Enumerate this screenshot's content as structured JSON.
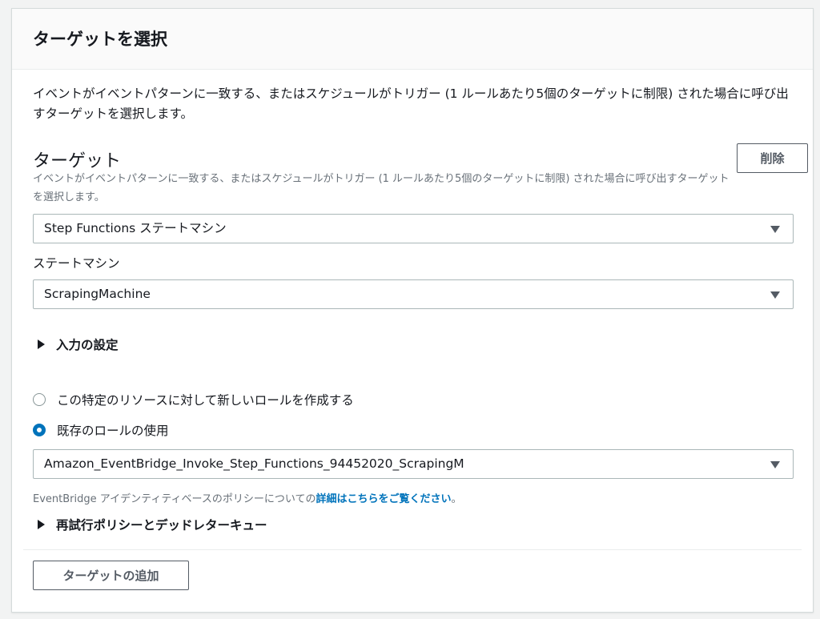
{
  "panel": {
    "title": "ターゲットを選択",
    "intro": "イベントがイベントパターンに一致する、またはスケジュールがトリガー (1 ルールあたり5個のターゲットに制限) された場合に呼び出すターゲットを選択します。"
  },
  "target": {
    "heading": "ターゲット",
    "description": "イベントがイベントパターンに一致する、またはスケジュールがトリガー (1 ルールあたり5個のターゲットに制限) された場合に呼び出すターゲットを選択します。",
    "delete_label": "削除",
    "type_select": "Step Functions ステートマシン",
    "state_machine_label": "ステートマシン",
    "state_machine_select": "ScrapingMachine",
    "input_settings_label": "入力の設定"
  },
  "role": {
    "create_new_label": "この特定のリソースに対して新しいロールを作成する",
    "use_existing_label": "既存のロールの使用",
    "selected_option": "use_existing",
    "existing_role_select": "Amazon_EventBridge_Invoke_Step_Functions_94452020_ScrapingM",
    "help_prefix": "EventBridge アイデンティティベースのポリシーについての",
    "help_link": "詳細はこちらをご覧ください",
    "help_suffix": "。"
  },
  "retry_label": "再試行ポリシーとデッドレターキュー",
  "add_target_label": "ターゲットの追加",
  "colors": {
    "accent": "#0073bb",
    "text": "#16191f",
    "muted": "#687078"
  }
}
